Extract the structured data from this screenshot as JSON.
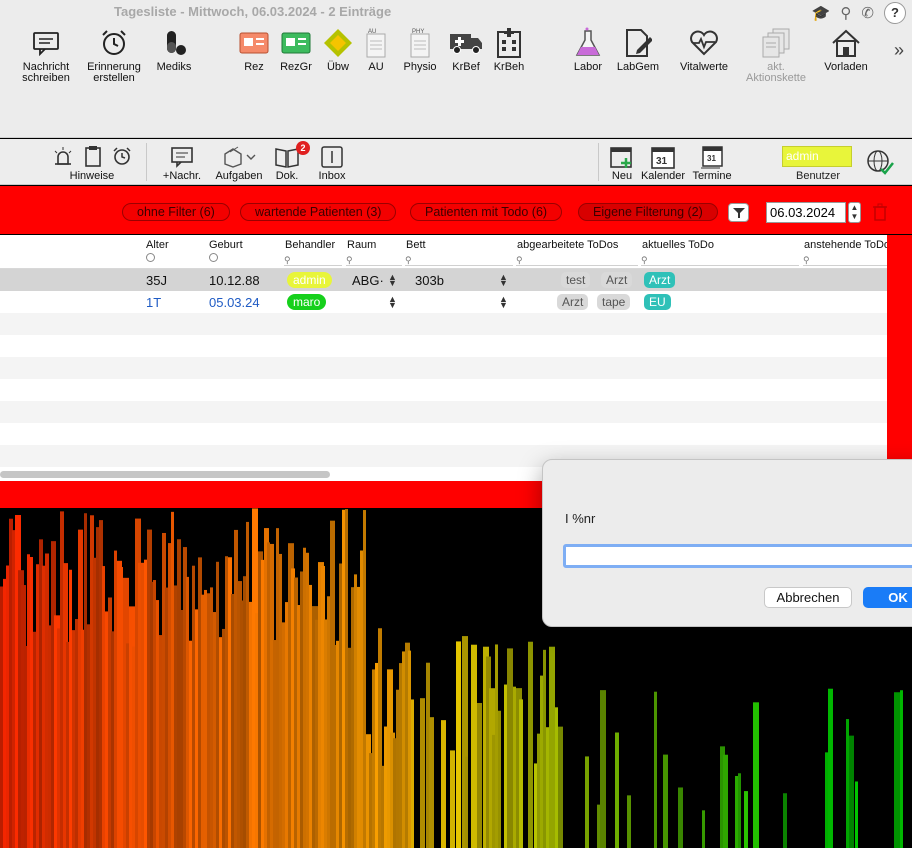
{
  "window": {
    "title": "Tagesliste - Mittwoch, 06.03.2024 - 2 Einträge"
  },
  "system": {
    "help_label": "?"
  },
  "toolbar": {
    "items": [
      {
        "label": "Nachricht schreiben",
        "icon": "message-icon"
      },
      {
        "label": "Erinnerung erstellen",
        "icon": "alarm-clock-icon"
      },
      {
        "label": "Mediks",
        "icon": "pills-icon"
      },
      {
        "label": "Rez",
        "icon": "prescription-icon"
      },
      {
        "label": "RezGr",
        "icon": "prescription-green-icon"
      },
      {
        "label": "Übw",
        "icon": "referral-icon"
      },
      {
        "label": "AU",
        "icon": "document-icon"
      },
      {
        "label": "Physio",
        "icon": "document-icon"
      },
      {
        "label": "KrBef",
        "icon": "ambulance-icon"
      },
      {
        "label": "KrBeh",
        "icon": "hospital-icon"
      },
      {
        "label": "Labor",
        "icon": "flask-icon"
      },
      {
        "label": "LabGem",
        "icon": "document-edit-icon"
      },
      {
        "label": "Vitalwerte",
        "icon": "heart-pulse-icon"
      },
      {
        "label": "akt. Aktionskette",
        "icon": "stack-icon"
      },
      {
        "label": "Vorladen",
        "icon": "house-icon"
      }
    ],
    "au_tag": "AU",
    "physio_tag": "PHY",
    "more": "»"
  },
  "toolbar2": {
    "hinweise": "Hinweise",
    "nachr": "+Nachr.",
    "aufgaben": "Aufgaben",
    "dok": "Dok.",
    "dok_badge": "2",
    "inbox": "Inbox",
    "neu": "Neu",
    "kalender": "Kalender",
    "termine": "Termine",
    "kalender_day": "31",
    "termine_day": "31",
    "user_value": "admin",
    "user_label": "Benutzer"
  },
  "filters": {
    "buttons": [
      {
        "label": "ohne Filter (6)"
      },
      {
        "label": "wartende Patienten (3)"
      },
      {
        "label": "Patienten mit Todo (6)"
      },
      {
        "label": "Eigene Filterung (2)"
      }
    ],
    "date": "06.03.2024",
    "accent": "#ff0000"
  },
  "table": {
    "columns": [
      "Alter",
      "Geburt",
      "Behandler",
      "Raum",
      "Bett",
      "abgearbeitete ToDos",
      "aktuelles ToDo",
      "anstehende ToDos"
    ],
    "rows": [
      {
        "alter": "35J",
        "geburt": "10.12.88",
        "behandler": "admin",
        "raum": "ABG·",
        "bett": "303b",
        "done": [
          "test",
          "Arzt"
        ],
        "current": "Arzt"
      },
      {
        "alter": "1T",
        "geburt": "05.03.24",
        "behandler": "maro",
        "raum": "",
        "bett": "",
        "done": [
          "Arzt",
          "tape"
        ],
        "current": "EU"
      }
    ]
  },
  "dialog": {
    "message": "I %nr",
    "input_value": "",
    "cancel_label": "Abbrechen",
    "ok_label": "OK"
  }
}
